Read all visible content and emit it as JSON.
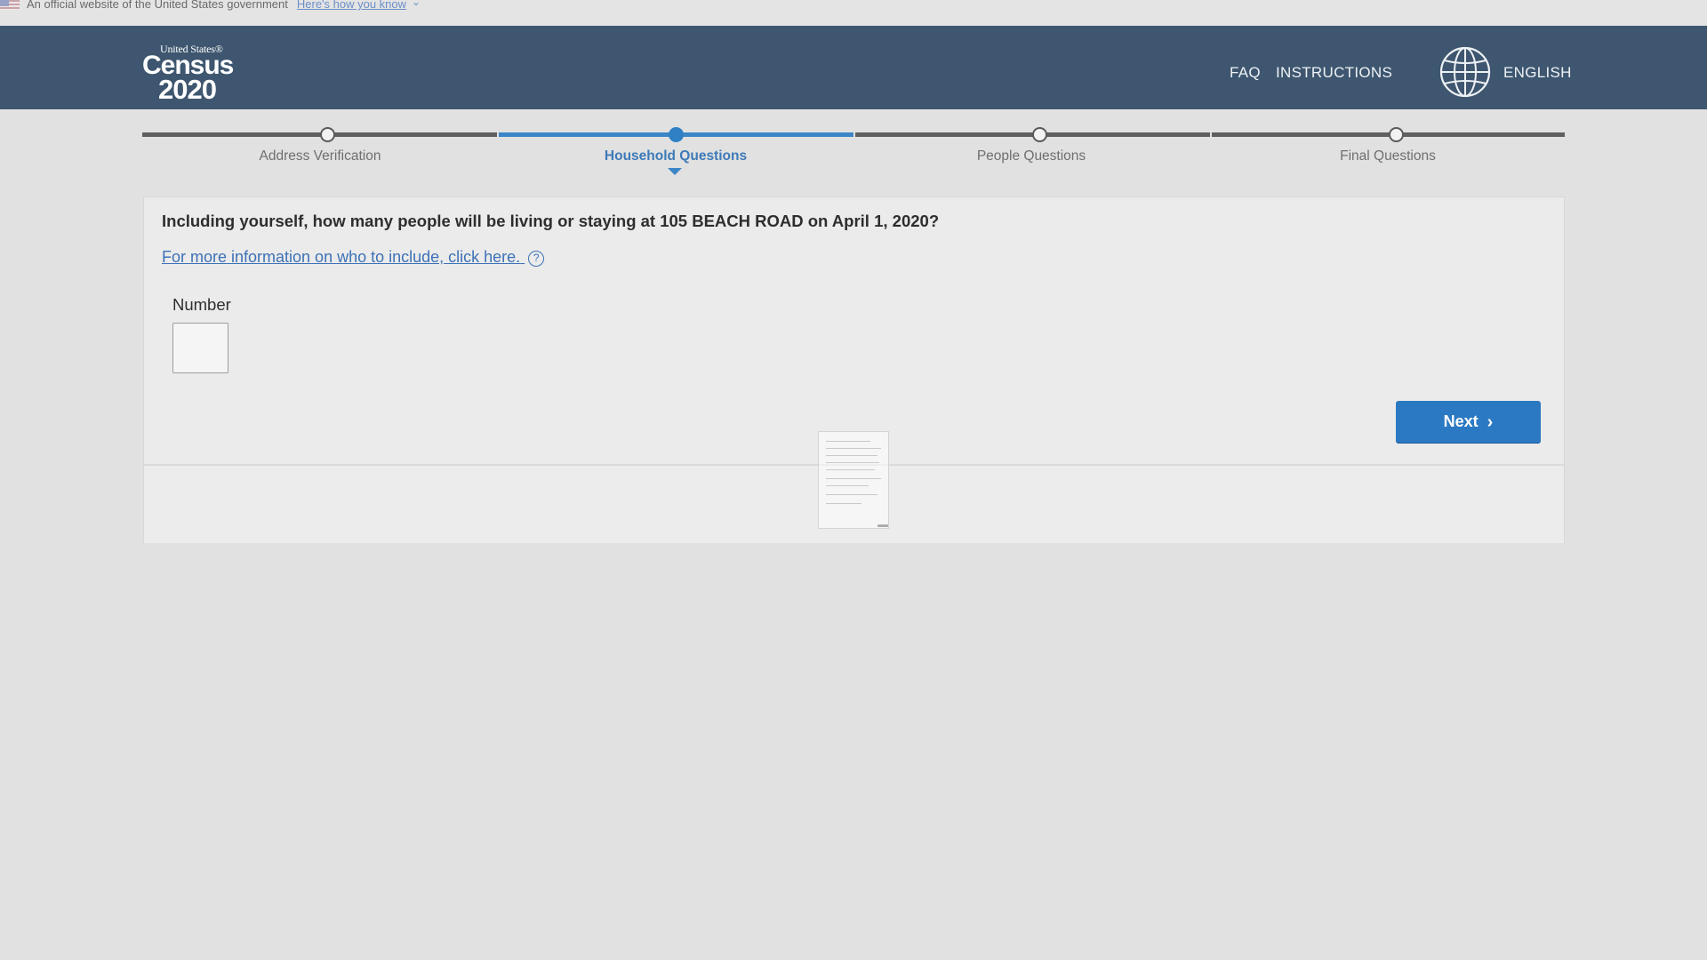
{
  "gov_banner": {
    "text": "An official website of the United States government",
    "link": "Here's how you know"
  },
  "header": {
    "logo": {
      "top": "United States®",
      "mid": "Census",
      "year": "2020"
    },
    "nav": {
      "faq": "FAQ",
      "instructions": "INSTRUCTIONS",
      "language": "ENGLISH"
    }
  },
  "progress": {
    "steps": [
      {
        "label": "Address Verification",
        "state": "complete"
      },
      {
        "label": "Household Questions",
        "state": "current"
      },
      {
        "label": "People Questions",
        "state": "upcoming"
      },
      {
        "label": "Final Questions",
        "state": "upcoming"
      }
    ],
    "current_index": 1
  },
  "question": {
    "text": "Including yourself, how many people will be living or staying at 105 BEACH ROAD on April 1, 2020?",
    "info_link": "For more information on who to include, click here.",
    "field_label": "Number",
    "field_value": ""
  },
  "actions": {
    "next_label": "Next"
  },
  "colors": {
    "header_bg": "#3e566f",
    "accent": "#2b79c2",
    "page_bg": "#e1e1e1"
  }
}
